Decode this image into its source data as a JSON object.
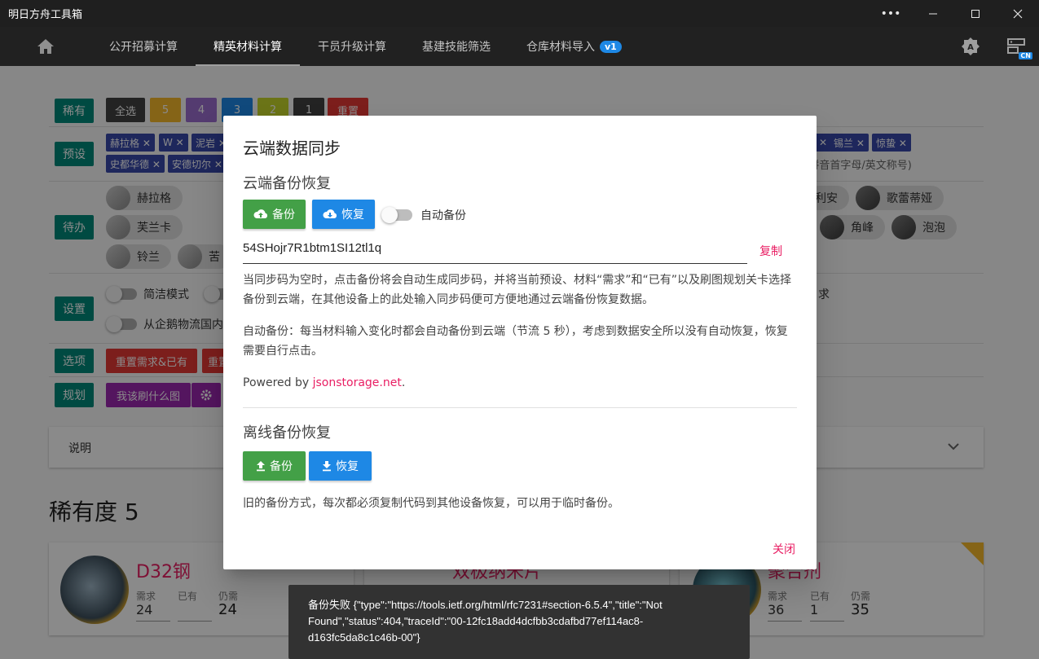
{
  "window": {
    "title": "明日方舟工具箱"
  },
  "nav": {
    "tabs": [
      "公开招募计算",
      "精英材料计算",
      "干员升级计算",
      "基建技能筛选",
      "仓库材料导入"
    ],
    "active_tab_index": 1,
    "import_badge": "v1",
    "lang_badge": "CN"
  },
  "background": {
    "rarity": {
      "label": "稀有",
      "select_all": "全选",
      "r5": "5",
      "r4": "4",
      "r3": "3",
      "r2": "2",
      "r1": "1",
      "reset": "重置"
    },
    "preset": {
      "label": "预设",
      "chips_row1": [
        "赫拉格 ✕",
        "W ✕",
        "泥岩 ✕"
      ],
      "chips_row2": [
        "史都华德 ✕",
        "安德切尔 ✕"
      ],
      "chips_right": [
        "✕",
        "锡兰 ✕",
        "惊蛰 ✕"
      ],
      "hint": "/拼音首字母/英文称号)"
    },
    "todo": {
      "label": "待办",
      "ops_left": [
        "赫拉格",
        "芙兰卡",
        "铃兰",
        "苦"
      ],
      "ops_right": [
        "利安",
        "歌蕾蒂娅",
        "角峰",
        "泡泡"
      ]
    },
    "settings": {
      "label": "设置",
      "simple_mode": "简洁模式",
      "from_penguin": "从企鹅物流国内",
      "right_fragment": "求"
    },
    "options": {
      "label": "选项",
      "reset_need_have": "重置需求&已有",
      "reset2": "重置"
    },
    "plan": {
      "label": "规划",
      "what_to_farm": "我该刷什么图"
    },
    "description": "说明",
    "section_title": "稀有度 5",
    "cards": [
      {
        "name": "D32钢",
        "need_label": "需求",
        "have_label": "已有",
        "still_label": "仍需",
        "need": "24",
        "have": "",
        "still": "24"
      },
      {
        "name": "双极纳米片"
      },
      {
        "name": "聚合剂",
        "need_label": "需求",
        "have_label": "已有",
        "still_label": "仍需",
        "need": "36",
        "have": "1",
        "still": "35"
      }
    ]
  },
  "dialog": {
    "title": "云端数据同步",
    "cloud_section": "云端备份恢复",
    "backup_btn": "备份",
    "restore_btn": "恢复",
    "auto_backup_label": "自动备份",
    "sync_code": "54SHojr7R1btm1SI12tl1q",
    "copy_label": "复制",
    "para1": "当同步码为空时，点击备份将会自动生成同步码，并将当前预设、材料“需求”和“已有”以及刷图规划关卡选择备份到云端，在其他设备上的此处输入同步码便可方便地通过云端备份恢复数据。",
    "para2": "自动备份：每当材料输入变化时都会自动备份到云端（节流 5 秒），考虑到数据安全所以没有自动恢复，恢复需要自行点击。",
    "powered_prefix": "Powered by ",
    "powered_link": "jsonstorage.net",
    "powered_suffix": ".",
    "offline_section": "离线备份恢复",
    "offline_backup_btn": "备份",
    "offline_restore_btn": "恢复",
    "para3": "旧的备份方式，每次都必须复制代码到其他设备恢复，可以用于临时备份。",
    "close_label": "关闭"
  },
  "snackbar": {
    "message": "备份失败 {\"type\":\"https://tools.ietf.org/html/rfc7231#section-6.5.4\",\"title\":\"Not Found\",\"status\":404,\"traceId\":\"00-12fc18add4dcfbb3cdafbd77ef114ac8-d163fc5da8c1c46b-00\"}"
  },
  "colors": {
    "teal_label": "#00897b",
    "indigo_chip": "#3949ab",
    "green_btn": "#43a047",
    "blue_btn": "#1e88e5",
    "pink_accent": "#e91e63",
    "rarity_5": "#f6b92b",
    "rarity_4": "#9c6ecf",
    "rarity_3": "#1e88e5",
    "rarity_2": "#c6d62b",
    "rarity_1": "#424242",
    "reset_red": "#e53935"
  }
}
